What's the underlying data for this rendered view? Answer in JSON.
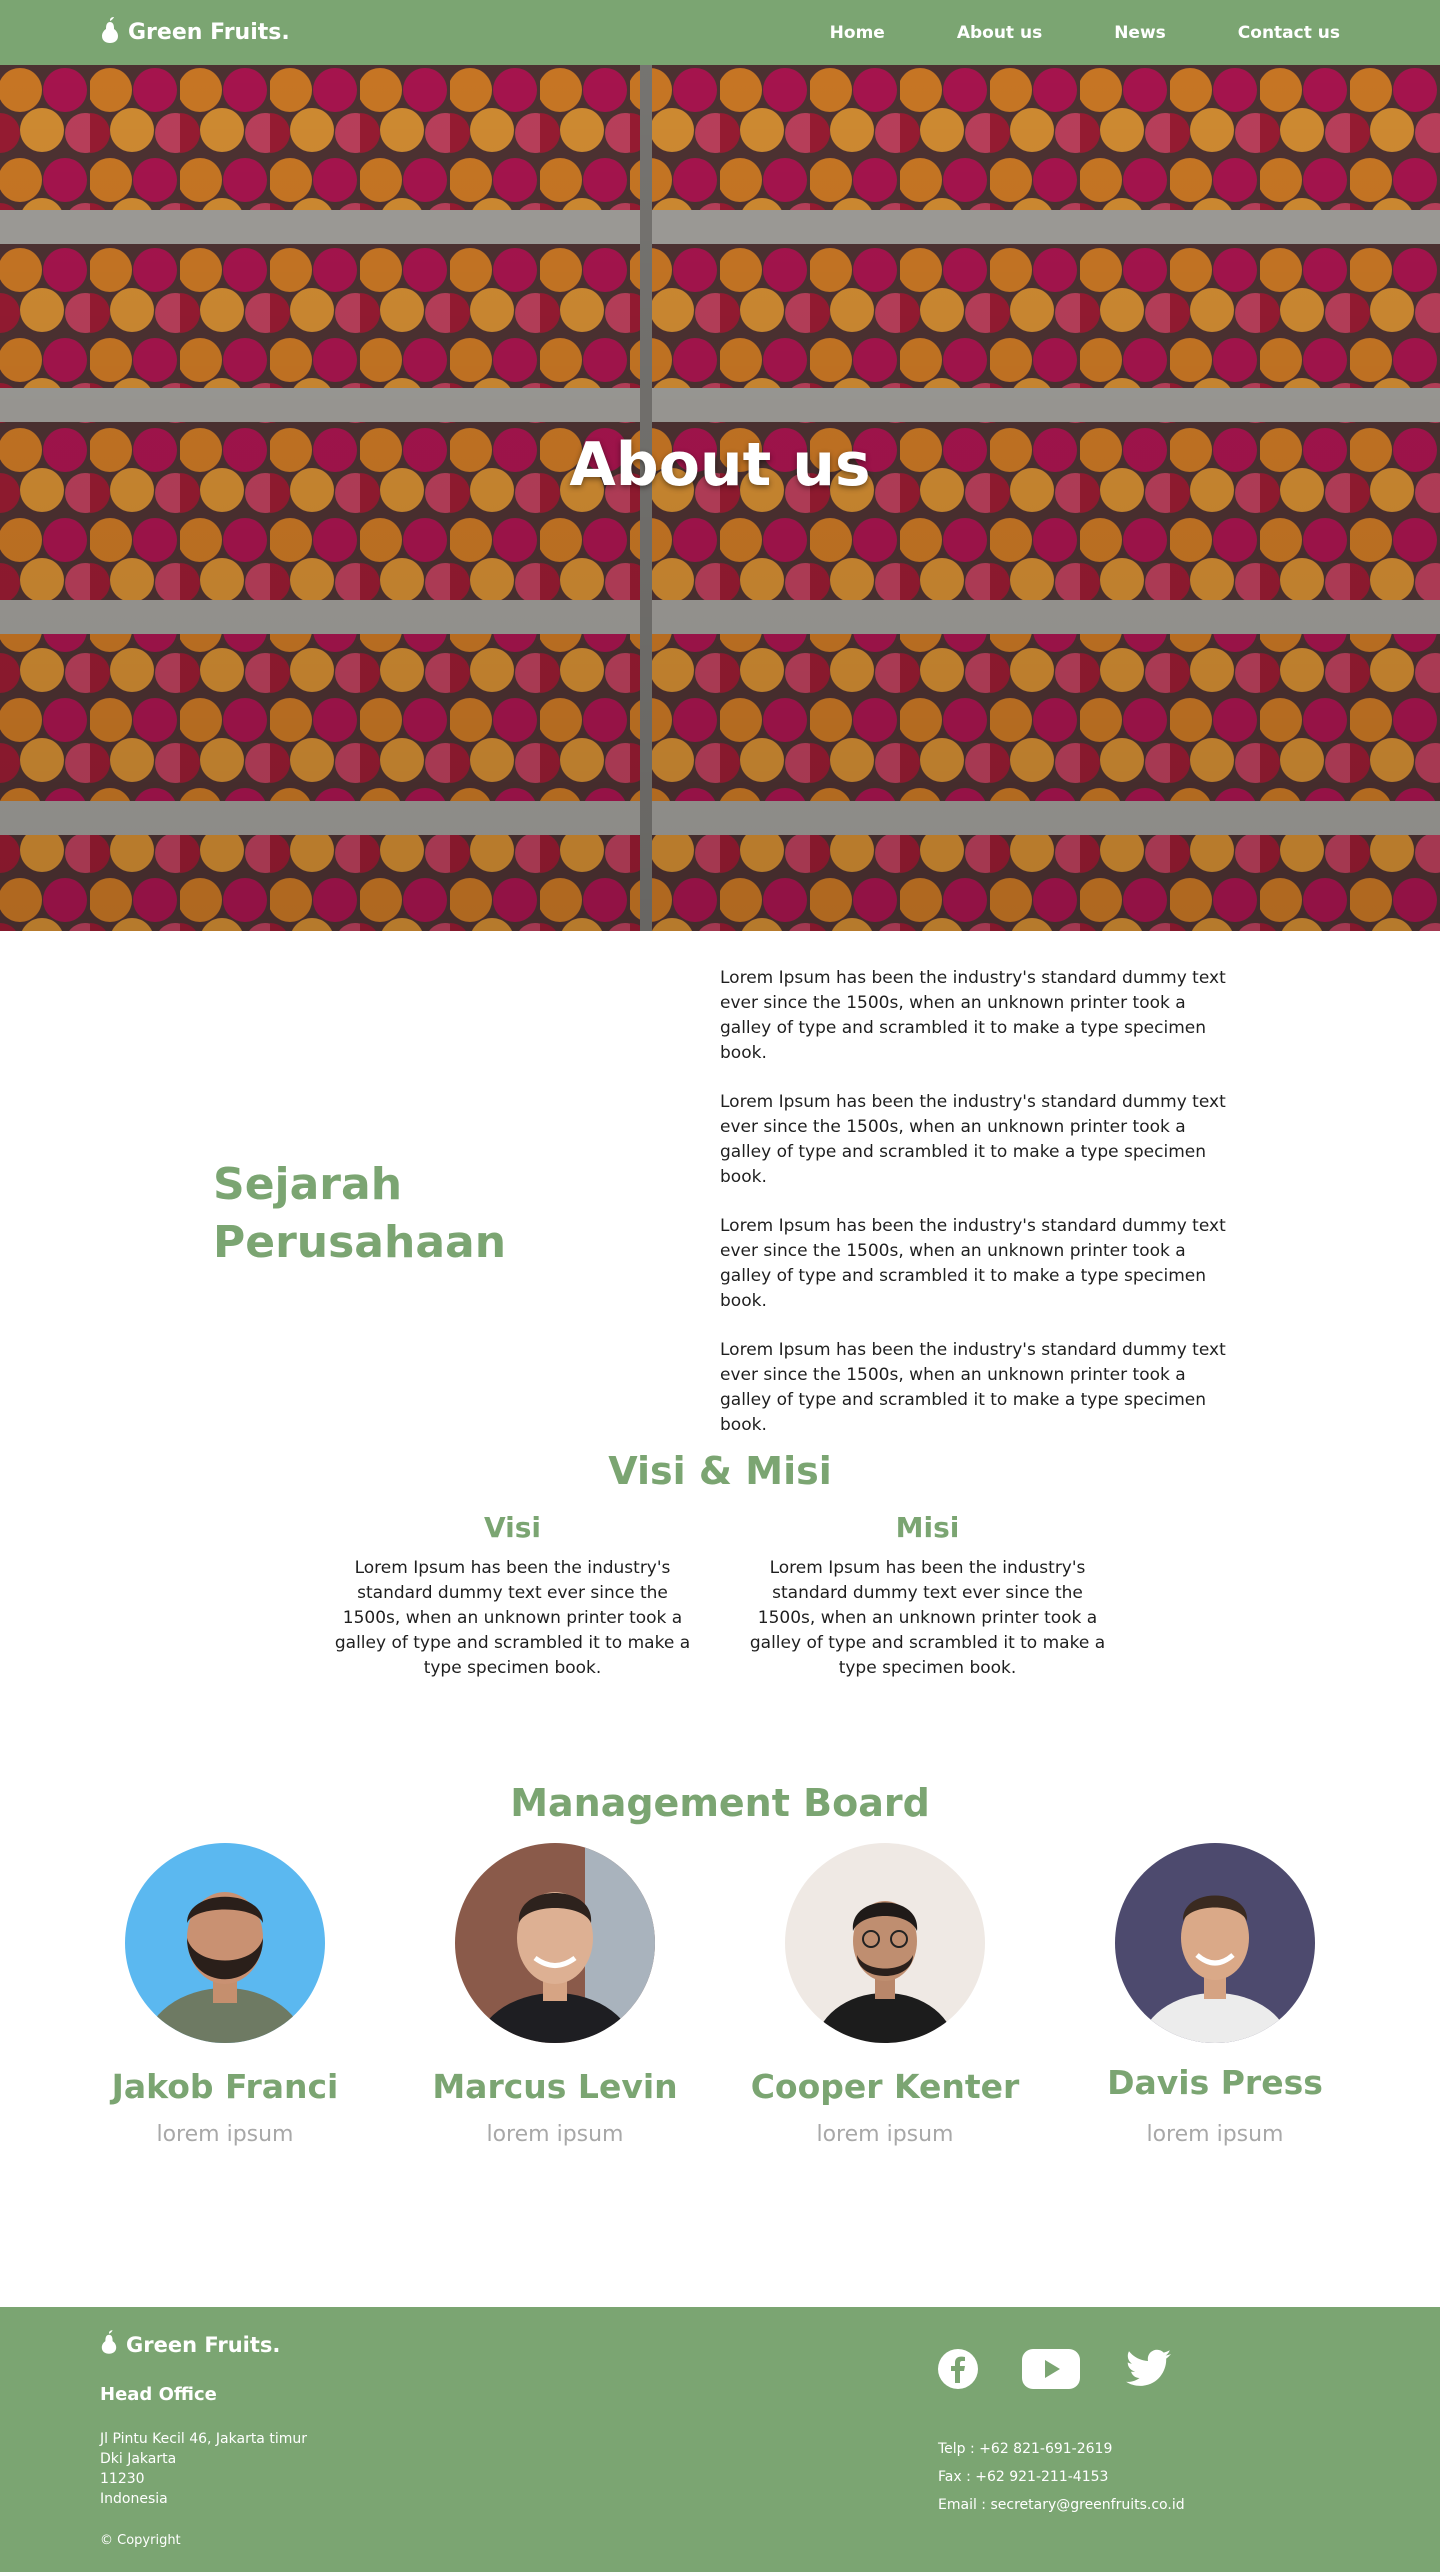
{
  "nav": {
    "brand": "Green Fruits.",
    "links": [
      "Home",
      "About us",
      "News",
      "Contact us"
    ]
  },
  "hero": {
    "title": "About us"
  },
  "history": {
    "title_line1": "Sejarah",
    "title_line2": "Perusahaan",
    "paragraphs": [
      "Lorem Ipsum has been the industry's standard dummy text ever since the 1500s, when an unknown printer took a galley of type and scrambled it to make a type specimen book.",
      "Lorem Ipsum has been the industry's standard dummy text ever since the 1500s, when an unknown printer took a galley of type and scrambled it to make a type specimen book.",
      "Lorem Ipsum has been the industry's standard dummy text ever since the 1500s, when an unknown printer took a galley of type and scrambled it to make a type specimen book.",
      "Lorem Ipsum has been the industry's standard dummy text ever since the 1500s, when an unknown printer took a galley of type and scrambled it to make a type specimen book."
    ]
  },
  "visi_misi": {
    "title": "Visi & Misi",
    "visi": {
      "heading": "Visi",
      "text": "Lorem Ipsum has been the industry's standard dummy text ever since the 1500s, when an unknown printer took a galley of type and scrambled it to make a type specimen book."
    },
    "misi": {
      "heading": "Misi",
      "text": "Lorem Ipsum has been the industry's standard dummy text ever since the 1500s, when an unknown printer took a galley of type and scrambled it to make a type specimen book."
    }
  },
  "board": {
    "title": "Management Board",
    "members": [
      {
        "name": "Jakob Franci",
        "role": "lorem ipsum",
        "bg": "#5bb8f0"
      },
      {
        "name": "Marcus Levin",
        "role": "lorem ipsum",
        "bg": "#8a5a4a"
      },
      {
        "name": "Cooper Kenter",
        "role": "lorem ipsum",
        "bg": "#efe9e4"
      },
      {
        "name": "Davis Press",
        "role": "lorem ipsum",
        "bg": "#4d4a6e"
      }
    ]
  },
  "footer": {
    "brand": "Green Fruits.",
    "office_title": "Head Office",
    "address": [
      "Jl Pintu Kecil 46, Jakarta timur",
      "Dki Jakarta",
      "11230",
      "Indonesia"
    ],
    "copyright": "© Copyright",
    "telp": "Telp : +62 821-691-2619",
    "fax": "Fax : +62 921-211-4153",
    "email": "Email : secretary@greenfruits.co.id",
    "socials": [
      "facebook-icon",
      "youtube-icon",
      "twitter-icon"
    ]
  },
  "colors": {
    "brand_green": "#7ba572",
    "muted_grey": "#a8a8a8"
  }
}
